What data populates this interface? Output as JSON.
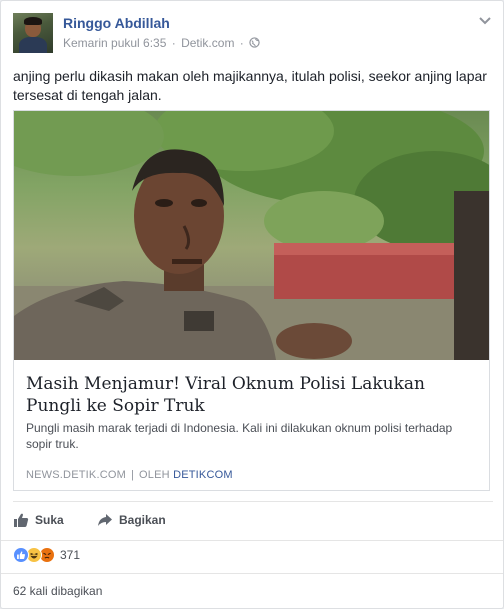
{
  "post": {
    "author": "Ringgo Abdillah",
    "timestamp": "Kemarin pukul 6:35",
    "separator": "·",
    "app": "Detik.com",
    "privacy_icon": "globe-icon",
    "menu_icon": "chevron-down-icon",
    "text": "anjing perlu dikasih makan oleh majikannya, itulah polisi, seekor anjing lapar tersesat di tengah jalan."
  },
  "link": {
    "title": "Masih Menjamur! Viral Oknum Polisi Lakukan Pungli ke Sopir Truk",
    "description": "Pungli masih marak terjadi di Indonesia. Kali ini dilakukan oknum polisi terhadap sopir truk.",
    "domain": "NEWS.DETIK.COM",
    "separator": "|",
    "by_label": "OLEH",
    "by_name": "DETIKCOM"
  },
  "actions": {
    "like_label": "Suka",
    "like_icon": "thumbs-up-icon",
    "share_label": "Bagikan",
    "share_icon": "share-arrow-icon"
  },
  "reactions": {
    "icons": [
      "like-reaction-icon",
      "haha-reaction-icon",
      "angry-reaction-icon"
    ],
    "count": "371"
  },
  "shares": {
    "text": "62 kali dibagikan"
  },
  "colors": {
    "author_link": "#365899",
    "like_blue": "#5890ff",
    "haha_yellow": "#f7c244",
    "angry_orange": "#e9710f"
  }
}
